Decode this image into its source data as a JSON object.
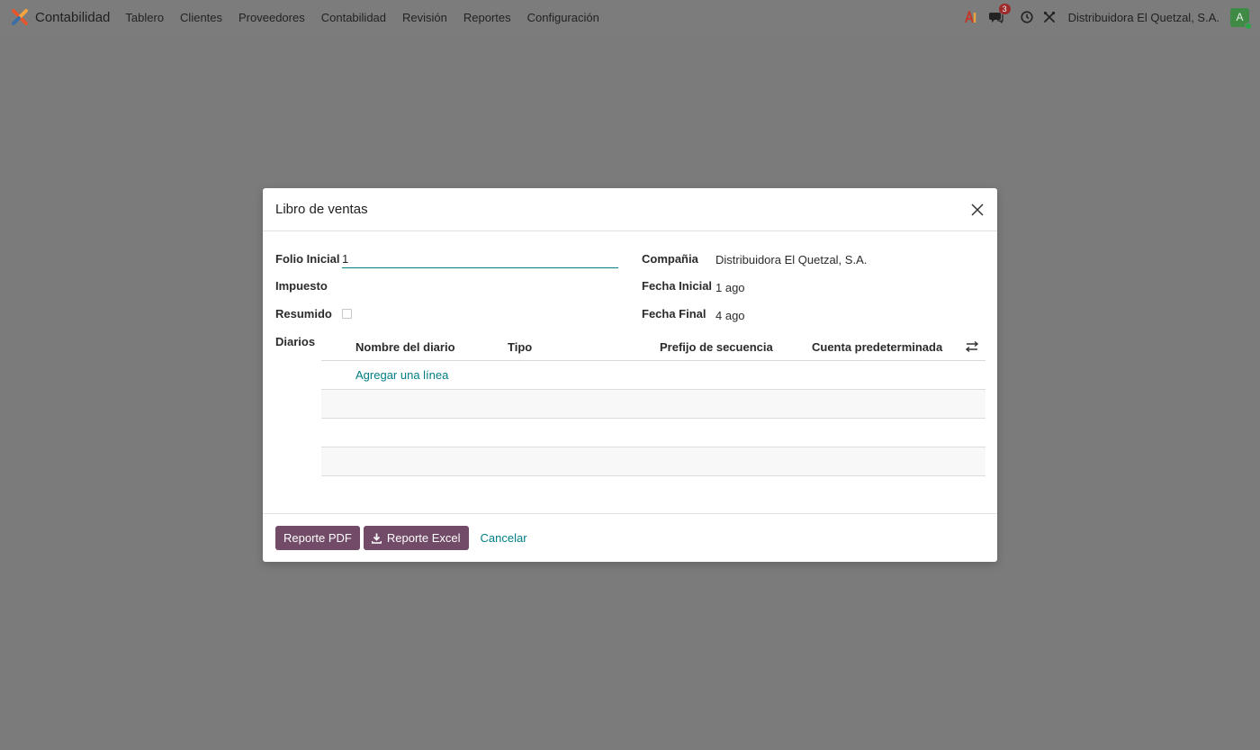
{
  "navbar": {
    "app_name": "Contabilidad",
    "menu": [
      "Tablero",
      "Clientes",
      "Proveedores",
      "Contabilidad",
      "Revisión",
      "Reportes",
      "Configuración"
    ],
    "messages_badge": "3",
    "company": "Distribuidora El Quetzal, S.A.",
    "avatar_letter": "A"
  },
  "modal": {
    "title": "Libro de ventas",
    "fields": {
      "folio_label": "Folio Inicial",
      "folio_value": "1",
      "impuesto_label": "Impuesto",
      "resumido_label": "Resumido",
      "diarios_label": "Diarios",
      "compania_label": "Compañia",
      "compania_value": "Distribuidora El Quetzal, S.A.",
      "fecha_inicial_label": "Fecha Inicial",
      "fecha_inicial_value": "1 ago",
      "fecha_final_label": "Fecha Final",
      "fecha_final_value": "4 ago"
    },
    "table": {
      "columns": [
        "Nombre del diario",
        "Tipo",
        "Prefijo de secuencia",
        "Cuenta predeterminada"
      ],
      "add_line": "Agregar una línea"
    },
    "footer": {
      "pdf_button": "Reporte PDF",
      "excel_button": "Reporte Excel",
      "cancel": "Cancelar"
    }
  },
  "colors": {
    "primary": "#714b67",
    "link": "#017e84",
    "backdrop": "#7b7b7b"
  }
}
